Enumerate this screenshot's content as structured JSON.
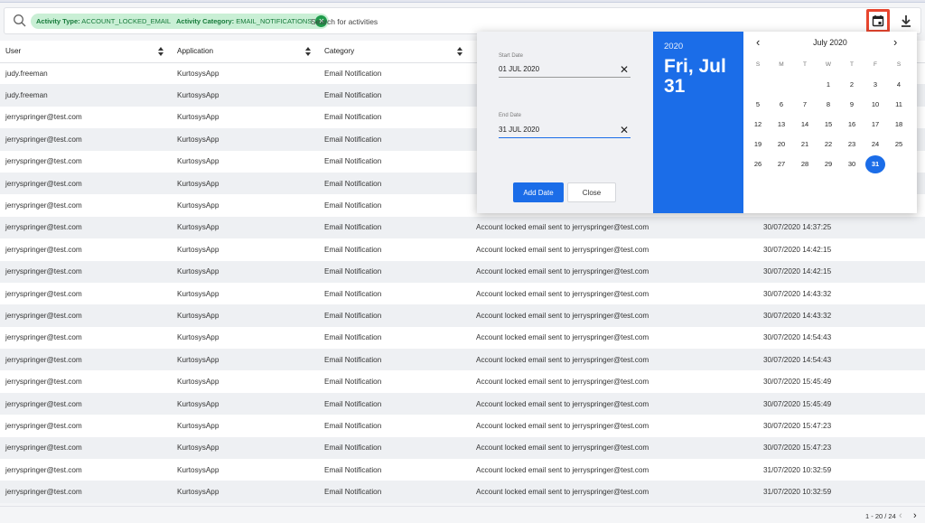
{
  "filters": [
    {
      "key": "Activity Type:",
      "value": "ACCOUNT_LOCKED_EMAIL"
    },
    {
      "key": "Activity Category:",
      "value": "EMAIL_NOTIFICATIONS"
    }
  ],
  "search": {
    "placeholder": "Search for activities"
  },
  "toolbar": {
    "calendar_icon": "calendar-icon",
    "download_icon": "download-icon",
    "highlight_color": "#e8462f"
  },
  "columns": [
    "User",
    "Application",
    "Category",
    ""
  ],
  "rows": [
    {
      "user": "judy.freeman",
      "app": "KurtosysApp",
      "category": "Email Notification",
      "description": "",
      "date": ""
    },
    {
      "user": "judy.freeman",
      "app": "KurtosysApp",
      "category": "Email Notification",
      "description": "",
      "date": ""
    },
    {
      "user": "jerryspringer@test.com",
      "app": "KurtosysApp",
      "category": "Email Notification",
      "description": "",
      "date": ""
    },
    {
      "user": "jerryspringer@test.com",
      "app": "KurtosysApp",
      "category": "Email Notification",
      "description": "",
      "date": ""
    },
    {
      "user": "jerryspringer@test.com",
      "app": "KurtosysApp",
      "category": "Email Notification",
      "description": "",
      "date": ""
    },
    {
      "user": "jerryspringer@test.com",
      "app": "KurtosysApp",
      "category": "Email Notification",
      "description": "",
      "date": ""
    },
    {
      "user": "jerryspringer@test.com",
      "app": "KurtosysApp",
      "category": "Email Notification",
      "description": "",
      "date": ""
    },
    {
      "user": "jerryspringer@test.com",
      "app": "KurtosysApp",
      "category": "Email Notification",
      "description": "Account locked email sent to jerryspringer@test.com",
      "date": "30/07/2020 14:37:25"
    },
    {
      "user": "jerryspringer@test.com",
      "app": "KurtosysApp",
      "category": "Email Notification",
      "description": "Account locked email sent to jerryspringer@test.com",
      "date": "30/07/2020 14:42:15"
    },
    {
      "user": "jerryspringer@test.com",
      "app": "KurtosysApp",
      "category": "Email Notification",
      "description": "Account locked email sent to jerryspringer@test.com",
      "date": "30/07/2020 14:42:15"
    },
    {
      "user": "jerryspringer@test.com",
      "app": "KurtosysApp",
      "category": "Email Notification",
      "description": "Account locked email sent to jerryspringer@test.com",
      "date": "30/07/2020 14:43:32"
    },
    {
      "user": "jerryspringer@test.com",
      "app": "KurtosysApp",
      "category": "Email Notification",
      "description": "Account locked email sent to jerryspringer@test.com",
      "date": "30/07/2020 14:43:32"
    },
    {
      "user": "jerryspringer@test.com",
      "app": "KurtosysApp",
      "category": "Email Notification",
      "description": "Account locked email sent to jerryspringer@test.com",
      "date": "30/07/2020 14:54:43"
    },
    {
      "user": "jerryspringer@test.com",
      "app": "KurtosysApp",
      "category": "Email Notification",
      "description": "Account locked email sent to jerryspringer@test.com",
      "date": "30/07/2020 14:54:43"
    },
    {
      "user": "jerryspringer@test.com",
      "app": "KurtosysApp",
      "category": "Email Notification",
      "description": "Account locked email sent to jerryspringer@test.com",
      "date": "30/07/2020 15:45:49"
    },
    {
      "user": "jerryspringer@test.com",
      "app": "KurtosysApp",
      "category": "Email Notification",
      "description": "Account locked email sent to jerryspringer@test.com",
      "date": "30/07/2020 15:45:49"
    },
    {
      "user": "jerryspringer@test.com",
      "app": "KurtosysApp",
      "category": "Email Notification",
      "description": "Account locked email sent to jerryspringer@test.com",
      "date": "30/07/2020 15:47:23"
    },
    {
      "user": "jerryspringer@test.com",
      "app": "KurtosysApp",
      "category": "Email Notification",
      "description": "Account locked email sent to jerryspringer@test.com",
      "date": "30/07/2020 15:47:23"
    },
    {
      "user": "jerryspringer@test.com",
      "app": "KurtosysApp",
      "category": "Email Notification",
      "description": "Account locked email sent to jerryspringer@test.com",
      "date": "31/07/2020 10:32:59"
    },
    {
      "user": "jerryspringer@test.com",
      "app": "KurtosysApp",
      "category": "Email Notification",
      "description": "Account locked email sent to jerryspringer@test.com",
      "date": "31/07/2020 10:32:59"
    }
  ],
  "pagination": {
    "text": "1 - 20 / 24",
    "prev_icon": "chevron-left-icon",
    "next_icon": "chevron-right-icon"
  },
  "datepicker": {
    "start_label": "Start Date",
    "start_value": "01 JUL 2020",
    "end_label": "End Date",
    "end_value": "31 JUL 2020",
    "add_label": "Add Date",
    "close_label": "Close",
    "year": "2020",
    "selected_display": "Fri, Jul 31",
    "month_label": "July 2020",
    "weekdays": [
      "S",
      "M",
      "T",
      "W",
      "T",
      "F",
      "S"
    ],
    "first_weekday_index": 3,
    "days_in_month": 31,
    "selected_day": 31,
    "accent_color": "#1b6de8"
  }
}
